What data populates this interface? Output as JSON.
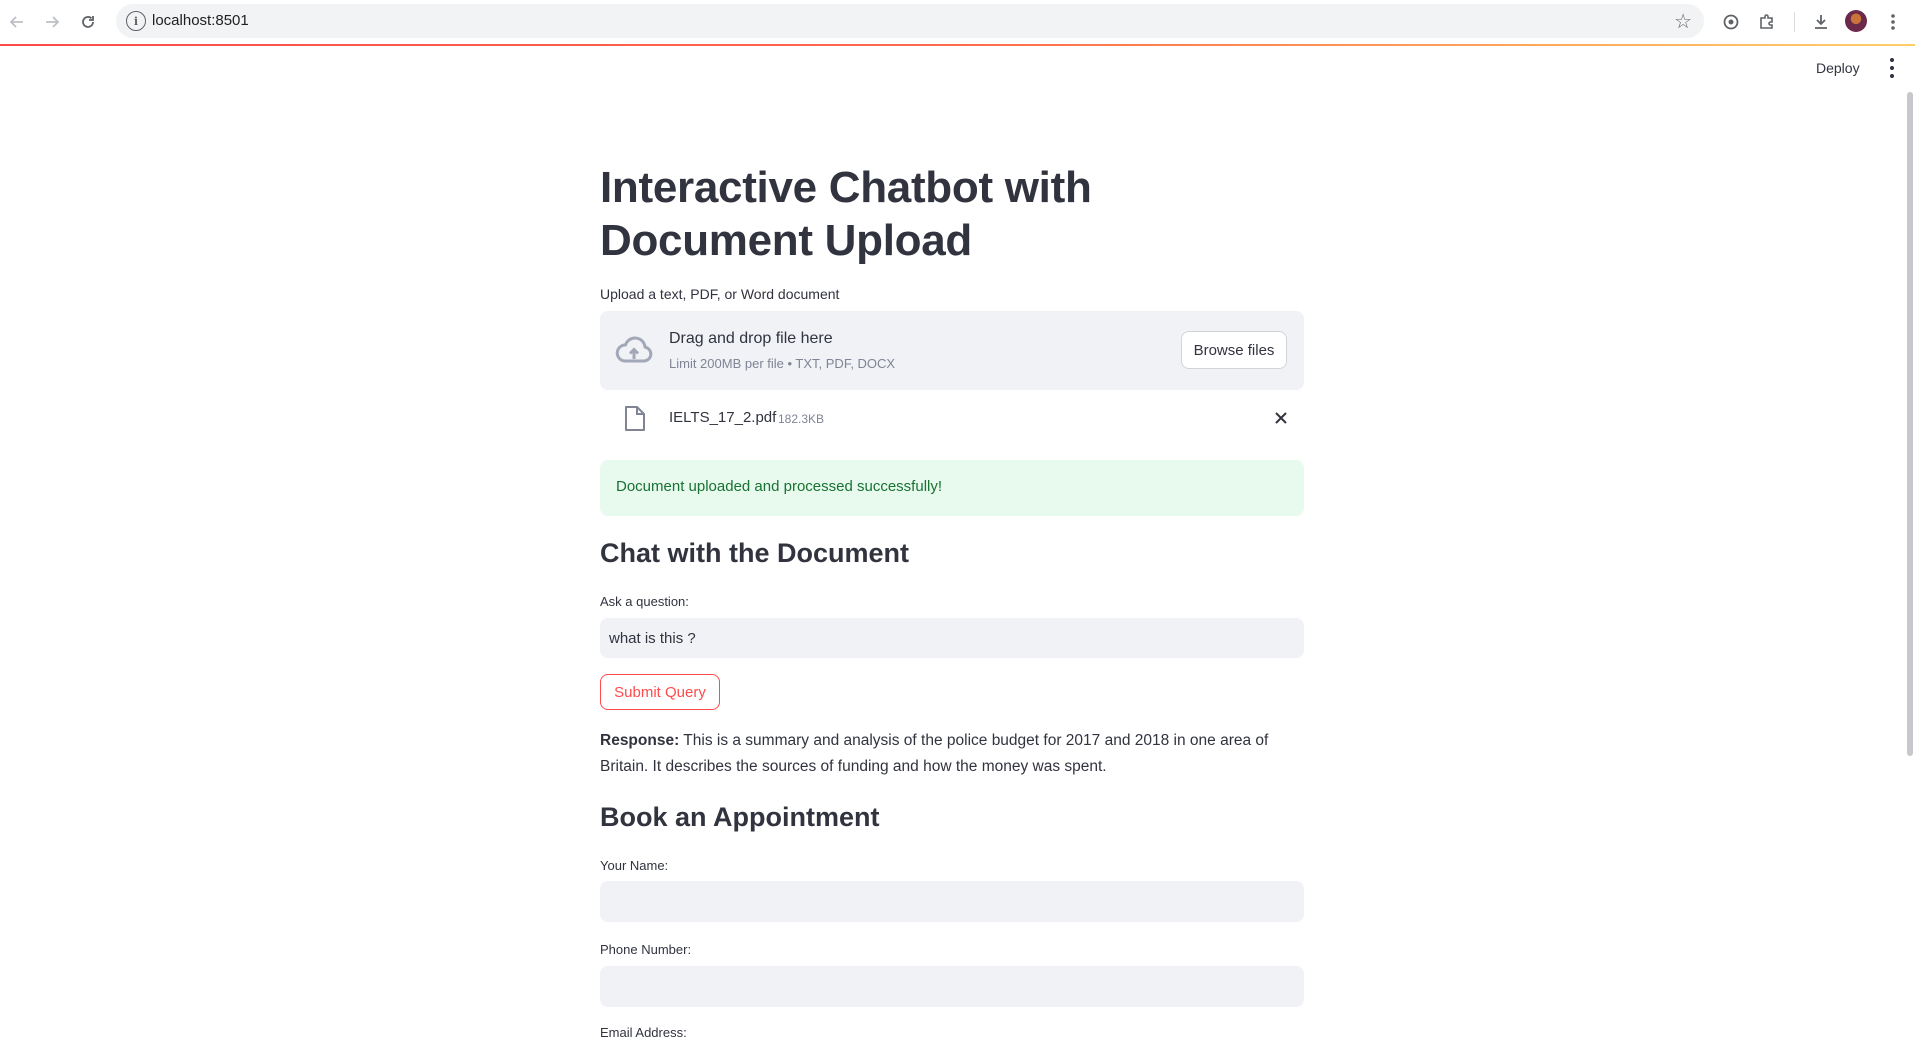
{
  "browser": {
    "url": "localhost:8501"
  },
  "header": {
    "deploy_label": "Deploy"
  },
  "main": {
    "title": "Interactive Chatbot with Document Upload",
    "uploader": {
      "label": "Upload a text, PDF, or Word document",
      "drop_title": "Drag and drop file here",
      "drop_limit": "Limit 200MB per file • TXT, PDF, DOCX",
      "browse_label": "Browse files"
    },
    "file": {
      "name": "IELTS_17_2.pdf",
      "size": "182.3KB"
    },
    "success_message": "Document uploaded and processed successfully!",
    "chat": {
      "heading": "Chat with the Document",
      "question_label": "Ask a question:",
      "question_value": "what is this ?",
      "submit_label": "Submit Query",
      "response_label": "Response:",
      "response_text": "This is a summary and analysis of the police budget for 2017 and 2018 in one area of Britain. It describes the sources of funding and how the money was spent."
    },
    "booking": {
      "heading": "Book an Appointment",
      "name_label": "Your Name:",
      "name_value": "",
      "phone_label": "Phone Number:",
      "phone_value": "",
      "email_label": "Email Address:"
    }
  },
  "colors": {
    "accent": "#ff4b4b",
    "success_bg": "#e8f9ee",
    "success_text": "#177233",
    "input_bg": "#f0f2f6"
  },
  "icons": {
    "back": "arrow-left-icon",
    "forward": "arrow-right-icon",
    "reload": "reload-icon",
    "site_info": "info-icon",
    "bookmark": "star-icon",
    "upload": "cloud-upload-icon",
    "file": "file-icon",
    "remove": "close-icon"
  }
}
